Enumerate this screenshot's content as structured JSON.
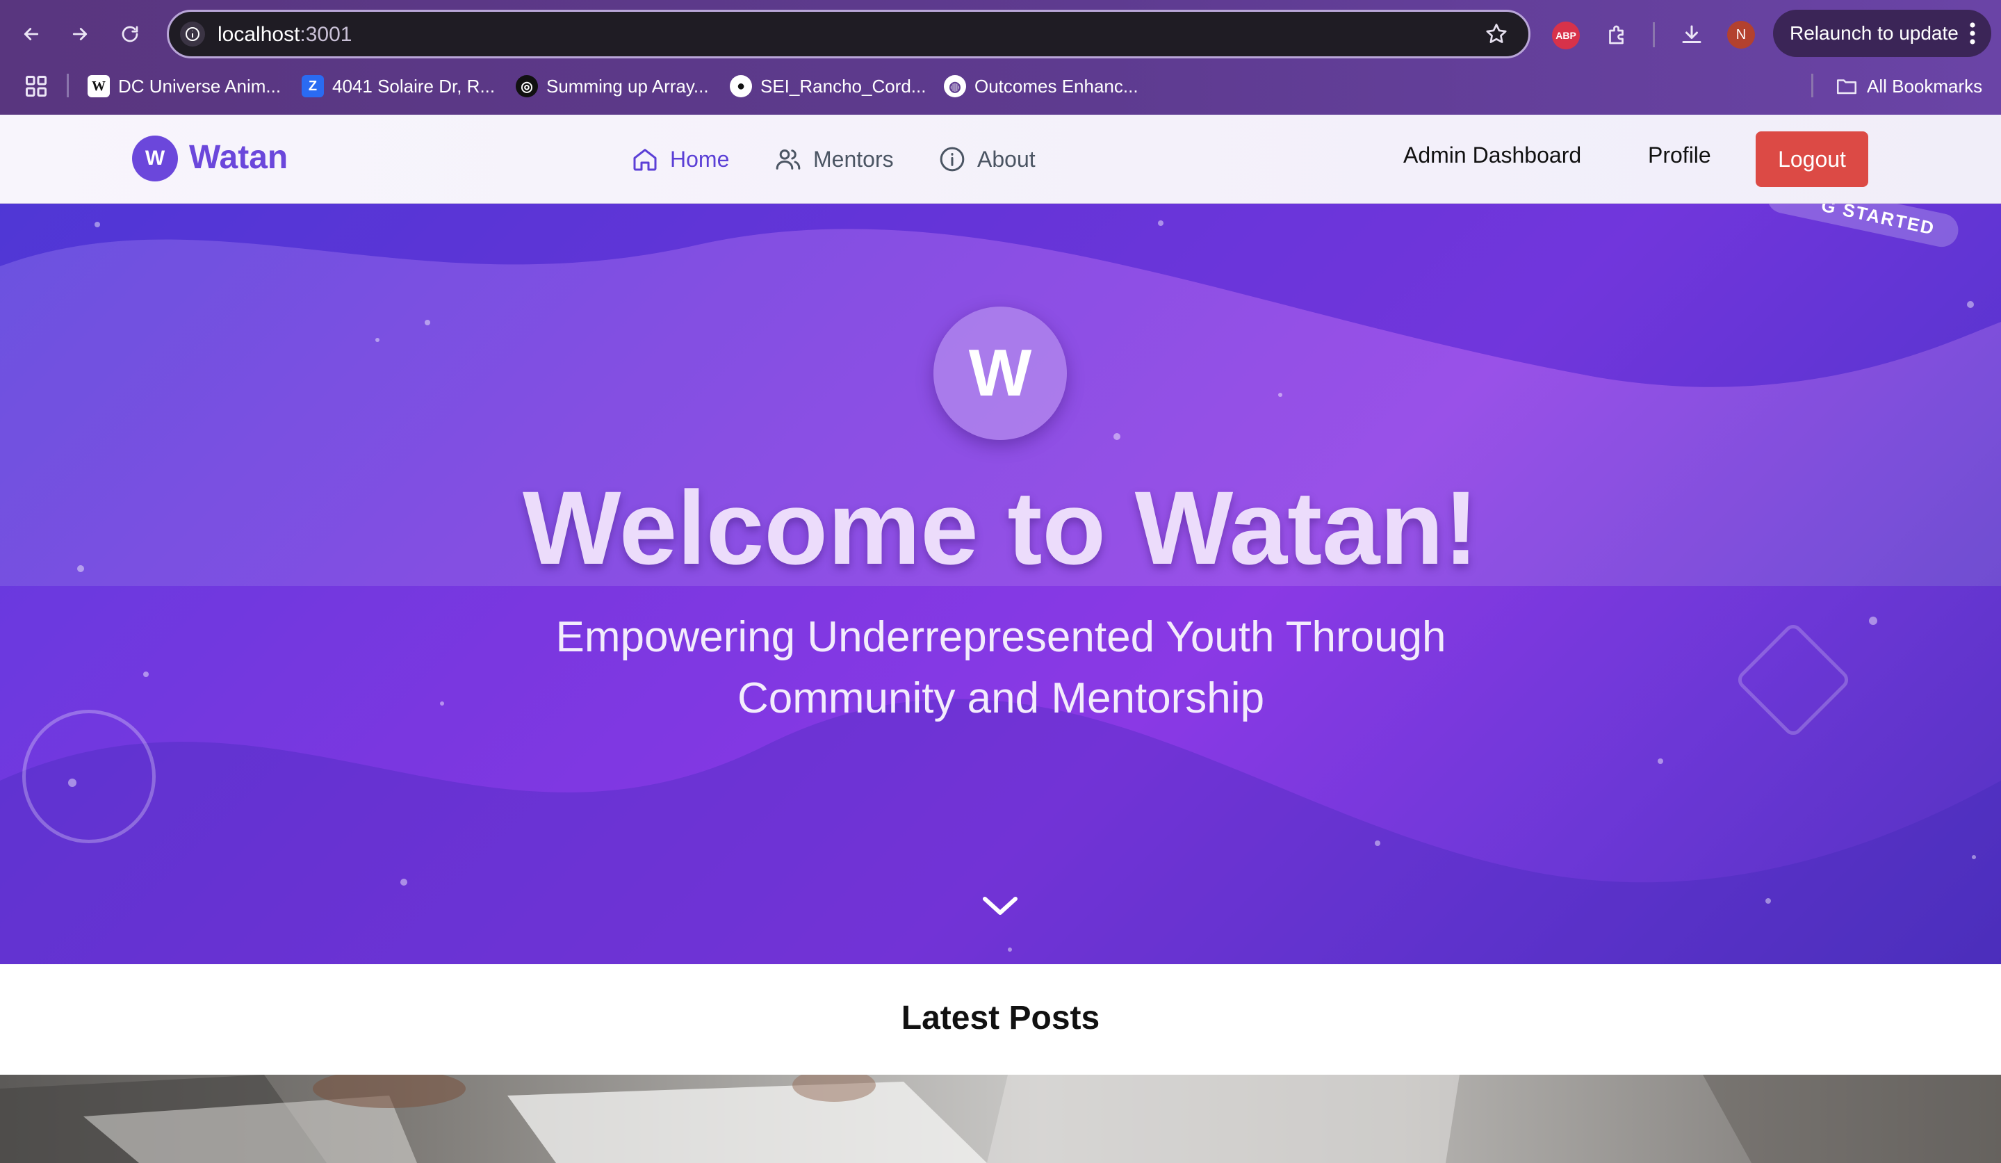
{
  "browser": {
    "url_host": "localhost",
    "url_port": ":3001",
    "relaunch_label": "Relaunch to update",
    "profile_initial": "N",
    "adblock_label": "ABP",
    "bookmarks": [
      {
        "label": "DC Universe Anim...",
        "icon": "wikipedia-icon",
        "glyph": "W"
      },
      {
        "label": "4041 Solaire Dr, R...",
        "icon": "zillow-icon",
        "glyph": "Z"
      },
      {
        "label": "Summing up Array...",
        "icon": "openai-icon",
        "glyph": "◎"
      },
      {
        "label": "SEI_Rancho_Cord...",
        "icon": "github-icon",
        "glyph": "●"
      },
      {
        "label": "Outcomes Enhanc...",
        "icon": "globe-icon",
        "glyph": "◍"
      }
    ],
    "all_bookmarks_label": "All Bookmarks"
  },
  "app": {
    "brand_initial": "W",
    "brand_name": "Watan",
    "nav": [
      {
        "label": "Home",
        "icon": "home-icon",
        "active": true
      },
      {
        "label": "Mentors",
        "icon": "users-icon",
        "active": false
      },
      {
        "label": "About",
        "icon": "info-icon",
        "active": false
      }
    ],
    "admin_label": "Admin Dashboard",
    "profile_label": "Profile",
    "logout_label": "Logout",
    "colors": {
      "brand": "#6b47db",
      "logout": "#dc4a45",
      "active_link": "#5b3fd6"
    }
  },
  "hero": {
    "ribbon_text": "G STARTED",
    "logo_initial": "W",
    "title": "Welcome to Watan!",
    "subtitle": "Empowering Underrepresented Youth Through Community and Mentorship",
    "colors": {
      "gradient_start": "#5a3fdc",
      "gradient_mid": "#8e3ee6",
      "gradient_end": "#4a35b8"
    }
  },
  "posts": {
    "heading": "Latest Posts"
  }
}
